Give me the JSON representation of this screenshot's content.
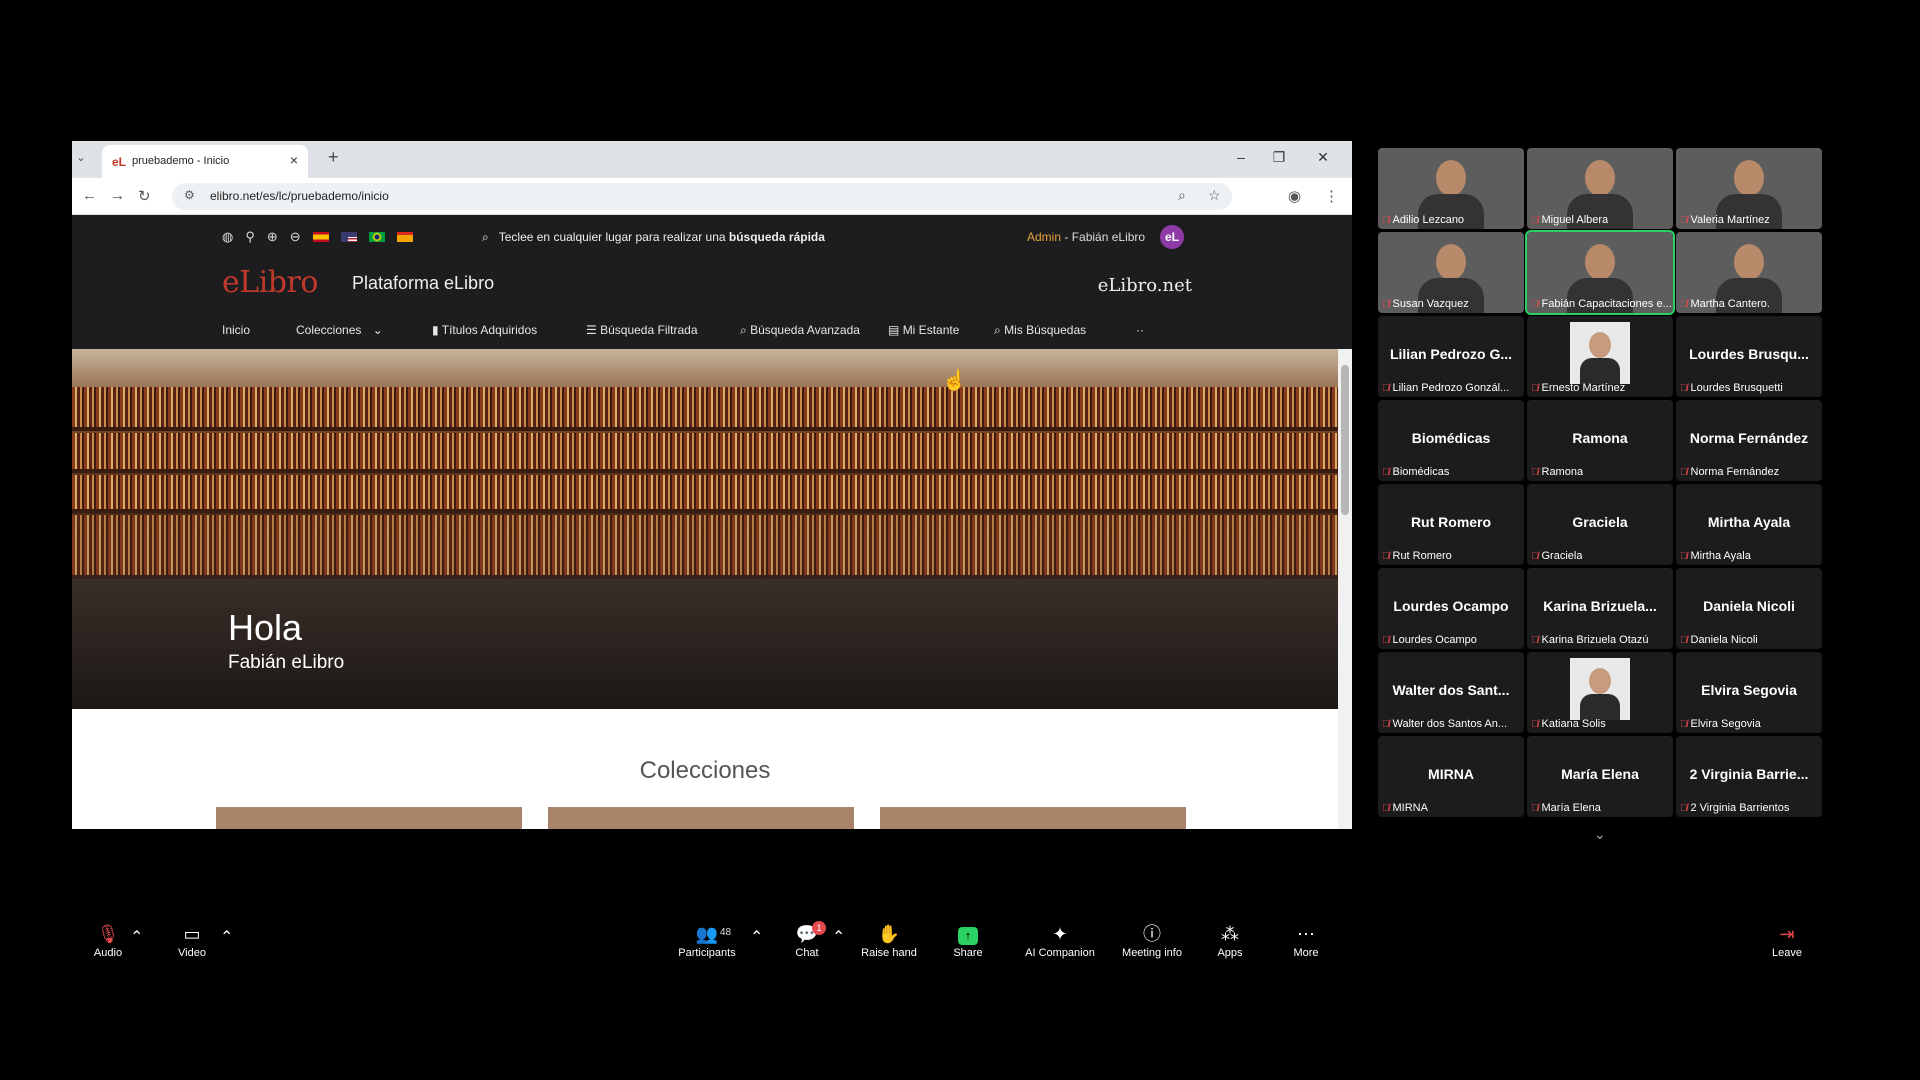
{
  "browser": {
    "tab_title": "pruebademo - Inicio",
    "url": "elibro.net/es/lc/pruebademo/inicio"
  },
  "site": {
    "search_hint_prefix": "Teclee en cualquier lugar para realizar una",
    "search_hint_bold": "búsqueda rápida",
    "admin_label": "Admin",
    "admin_user": "- Fabián eLibro",
    "avatar_initials": "eL",
    "logo": "eLibro",
    "platform": "Plataforma eLibro",
    "brand_right": "eLibro.net",
    "menu": {
      "inicio": "Inicio",
      "colecciones": "Colecciones",
      "titulos": "Títulos Adquiridos",
      "filtrada": "Búsqueda Filtrada",
      "avanzada": "Búsqueda Avanzada",
      "estante": "Mi Estante",
      "mis_busquedas": "Mis Búsquedas",
      "more": "··"
    },
    "hero_greeting": "Hola",
    "hero_name": "Fabián eLibro",
    "section_title": "Colecciones"
  },
  "participants": [
    {
      "name": "Adilio Lezcano",
      "display": "",
      "video": true
    },
    {
      "name": "Miguel Albera",
      "display": "",
      "video": true
    },
    {
      "name": "Valeria Martínez",
      "display": "",
      "video": true
    },
    {
      "name": "Susan Vazquez",
      "display": "",
      "video": true
    },
    {
      "name": "Fabián Capacitaciones e...",
      "display": "",
      "video": true
    },
    {
      "name": "Martha Cantero.",
      "display": "",
      "video": true
    },
    {
      "name": "Lilian Pedrozo Gonzál...",
      "display": "Lilian Pedrozo G...",
      "video": false
    },
    {
      "name": "Ernesto Martínez",
      "display": "",
      "video": true
    },
    {
      "name": "Lourdes Brusquetti",
      "display": "Lourdes Brusqu...",
      "video": false
    },
    {
      "name": "Biomédicas",
      "display": "Biomédicas",
      "video": false
    },
    {
      "name": "Ramona",
      "display": "Ramona",
      "video": false
    },
    {
      "name": "Norma Fernández",
      "display": "Norma Fernández",
      "video": false
    },
    {
      "name": "Rut Romero",
      "display": "Rut Romero",
      "video": false
    },
    {
      "name": "Graciela",
      "display": "Graciela",
      "video": false
    },
    {
      "name": "Mirtha Ayala",
      "display": "Mirtha Ayala",
      "video": false
    },
    {
      "name": "Lourdes Ocampo",
      "display": "Lourdes Ocampo",
      "video": false
    },
    {
      "name": "Karina Brizuela Otazú",
      "display": "Karina Brizuela...",
      "video": false
    },
    {
      "name": "Daniela Nicoli",
      "display": "Daniela Nicoli",
      "video": false
    },
    {
      "name": "Walter dos Santos An...",
      "display": "Walter dos Sant...",
      "video": false
    },
    {
      "name": "Katiana Solis",
      "display": "",
      "video": true
    },
    {
      "name": "Elvira Segovia",
      "display": "Elvira Segovia",
      "video": false
    },
    {
      "name": "MIRNA",
      "display": "MIRNA",
      "video": false
    },
    {
      "name": "María Elena",
      "display": "María Elena",
      "video": false
    },
    {
      "name": "2 Virginia Barrientos",
      "display": "2 Virginia Barrie...",
      "video": false
    }
  ],
  "toolbar": {
    "audio": "Audio",
    "video": "Video",
    "participants": "Participants",
    "participants_count": "48",
    "chat": "Chat",
    "chat_badge": "1",
    "raise_hand": "Raise hand",
    "share": "Share",
    "ai_companion": "AI Companion",
    "meeting_info": "Meeting info",
    "apps": "Apps",
    "more": "More",
    "leave": "Leave"
  },
  "colors": {
    "accent_red": "#c0392b",
    "active_speaker": "#2bd162",
    "muted": "#e5484d"
  }
}
